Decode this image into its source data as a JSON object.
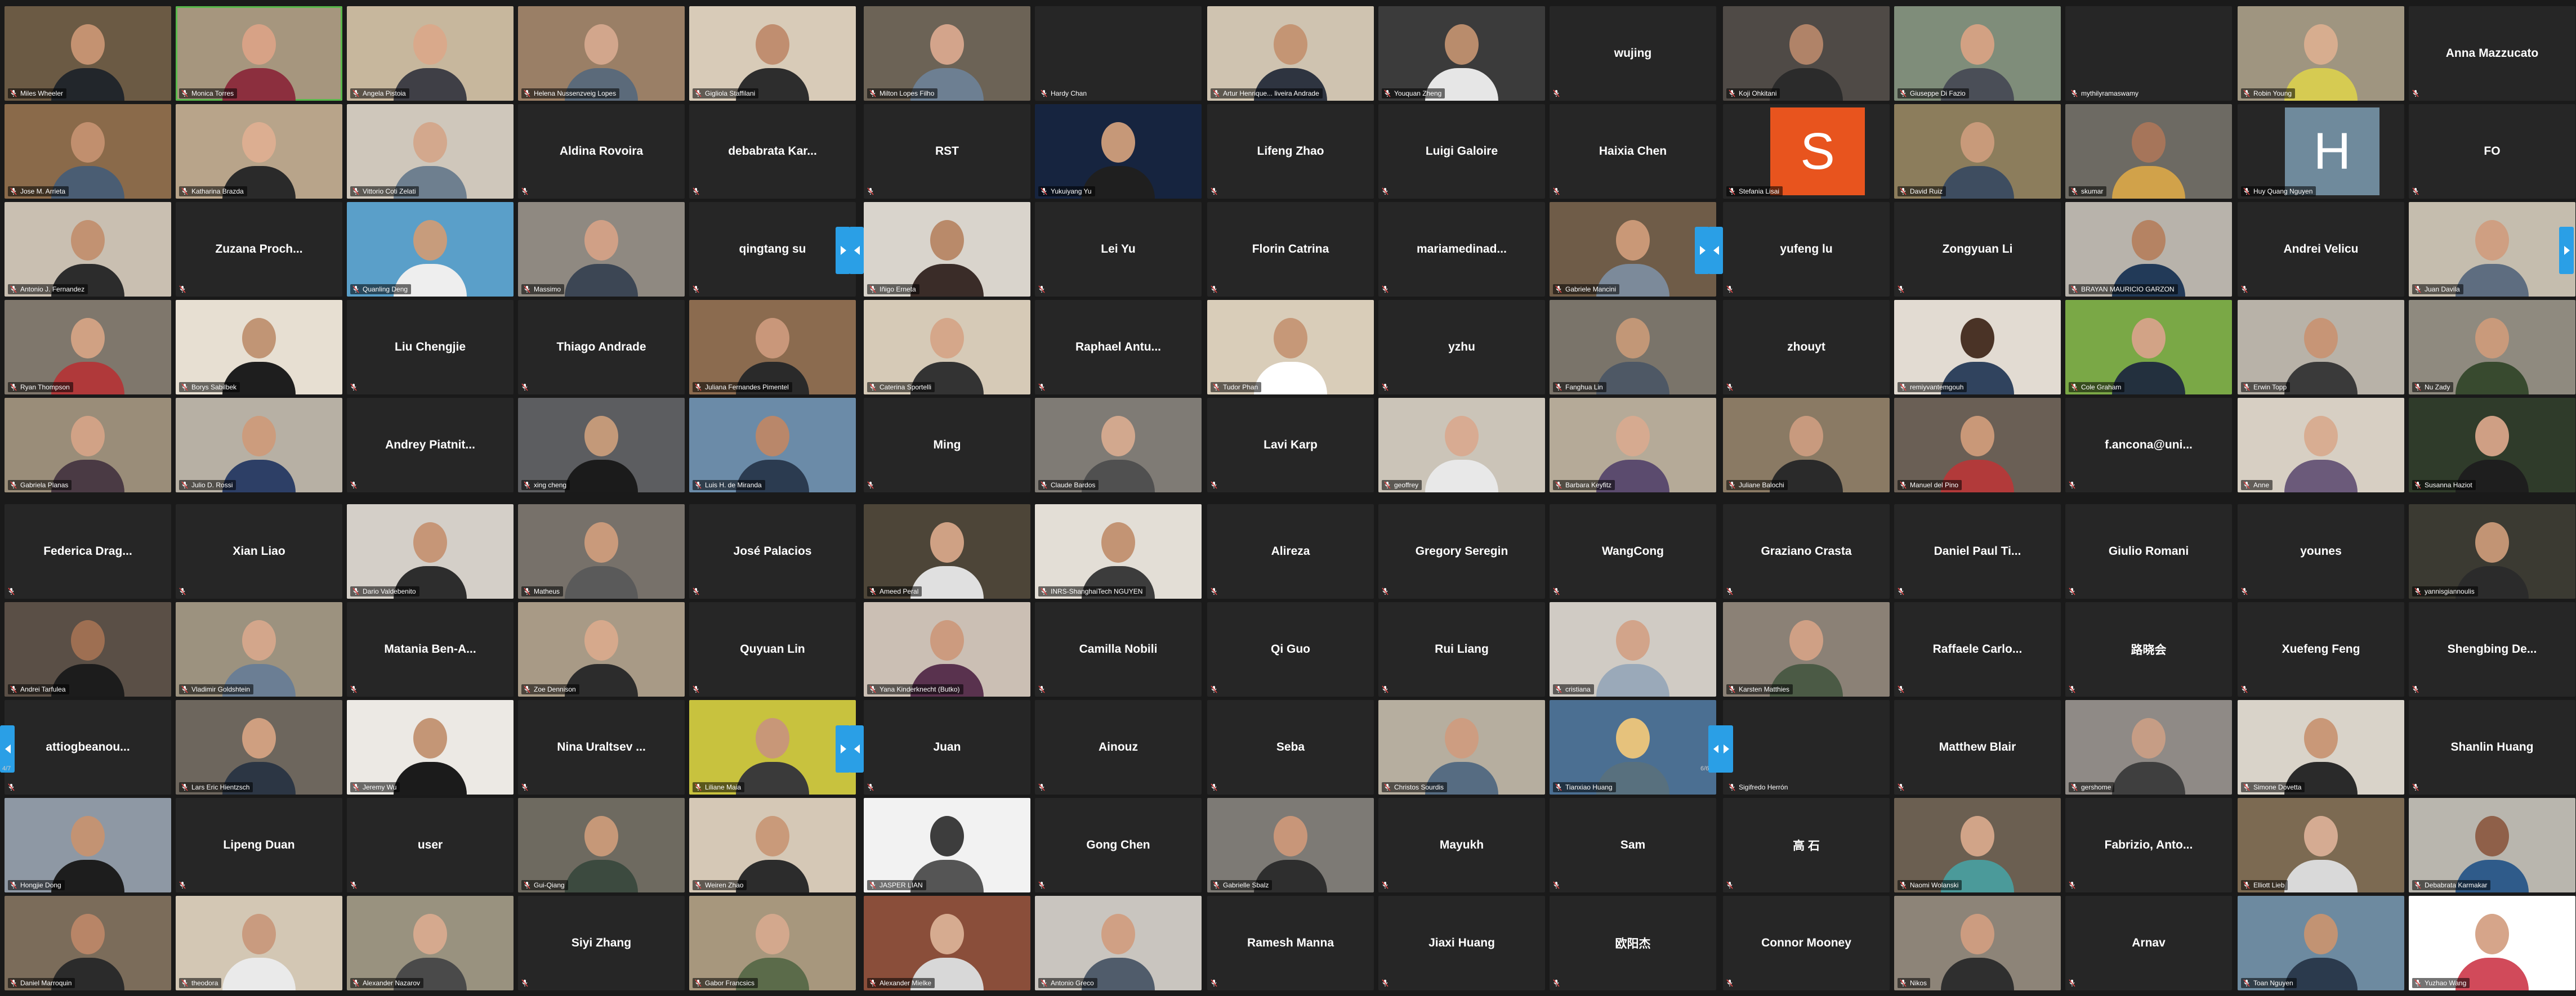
{
  "colors": {
    "background": "#1a1a1a",
    "tile_off": "#262626",
    "active_speaker_border": "#58b84b",
    "nav_arrow": "#2a9fe6",
    "mute_red": "#e34b4b"
  },
  "top": {
    "page_left": "",
    "page_mid": "",
    "page_right": "",
    "rows": [
      [
        {
          "name": "Miles Wheeler",
          "video": true,
          "bg": "#6b5a44",
          "skin": "#c49271",
          "shirt": "#22262b"
        },
        {
          "name": "Monica Torres",
          "video": true,
          "active": true,
          "bg": "#a6967e",
          "skin": "#d7a286",
          "shirt": "#8c2f3e"
        },
        {
          "name": "Angela Pistoia",
          "video": true,
          "bg": "#c7b79d",
          "skin": "#d9a98b",
          "shirt": "#3f3f46"
        },
        {
          "name": "Helena Nussenzveig Lopes",
          "video": true,
          "bg": "#9a7f66",
          "skin": "#d2a68c",
          "shirt": "#5b6a7a"
        },
        {
          "name": "Gigliola Staffilani",
          "video": true,
          "bg": "#d8cbb8",
          "skin": "#c08e70",
          "shirt": "#2d2d2d"
        },
        {
          "name": "Milton Lopes Filho",
          "video": true,
          "bg": "#6c6356",
          "skin": "#d3a48b",
          "shirt": "#6d7f92"
        },
        {
          "name": "Hardy Chan",
          "video": false,
          "label_bottom": true
        },
        {
          "name": "Artur Henrique... liveira Andrade",
          "video": true,
          "bg": "#cfc3b0",
          "skin": "#c49574",
          "shirt": "#2e3440"
        },
        {
          "name": "Youquan Zheng",
          "video": true,
          "bg": "#3b3b3b",
          "skin": "#b98c6c",
          "shirt": "#e6e6e6"
        },
        {
          "name": "wujing",
          "video": false
        },
        {
          "name": "Koji Ohkitani",
          "video": true,
          "bg": "#4f4a46",
          "skin": "#b08368",
          "shirt": "#2b2b2b"
        },
        {
          "name": "Giuseppe Di Fazio",
          "video": true,
          "bg": "#7f8d7a",
          "skin": "#d2a183",
          "shirt": "#4a4e57"
        },
        {
          "name": "mythilyramaswamy",
          "video": false,
          "label_bottom": true
        },
        {
          "name": "Robin Young",
          "video": true,
          "bg": "#9f9580",
          "skin": "#d7ad8f",
          "shirt": "#d6cb52"
        },
        {
          "name": "Anna Mazzucato",
          "video": false
        }
      ],
      [
        {
          "name": "Jose M. Arrieta",
          "video": true,
          "bg": "#8a6a4a",
          "skin": "#c18f6e",
          "shirt": "#4a5d73"
        },
        {
          "name": "Katharina Brazda",
          "video": true,
          "bg": "#b8a48a",
          "skin": "#dcae91",
          "shirt": "#2a2a2a"
        },
        {
          "name": "Vittorio Coti Zelati",
          "video": true,
          "bg": "#cfc7bb",
          "skin": "#d3a88d",
          "shirt": "#6e7f8f"
        },
        {
          "name": "Aldina Rovoira",
          "video": false
        },
        {
          "name": "debabrata Kar...",
          "video": false
        },
        {
          "name": "RST",
          "video": false
        },
        {
          "name": "Yukuiyang Yu",
          "video": true,
          "bg": "#16243f",
          "skin": "#c69878",
          "shirt": "#1f1f1f"
        },
        {
          "name": "Lifeng Zhao",
          "video": false
        },
        {
          "name": "Luigi Galoire",
          "video": false
        },
        {
          "name": "Haixia Chen",
          "video": false
        },
        {
          "name": "Stefania Lisai",
          "video": false,
          "avatar": "S",
          "avatar_color": "#e8541e",
          "label_bottom": true
        },
        {
          "name": "David Ruiz",
          "video": true,
          "bg": "#8c7d5c",
          "skin": "#c89a7a",
          "shirt": "#3e4d60"
        },
        {
          "name": "skumar",
          "video": true,
          "bg": "#6d6a63",
          "skin": "#a6755a",
          "shirt": "#d1a24a"
        },
        {
          "name": "Huy Quang Nguyen",
          "video": false,
          "avatar": "H",
          "avatar_color": "#6f8a9c",
          "label_bottom": true
        },
        {
          "name": "FO",
          "video": false
        }
      ],
      [
        {
          "name": "Antonio J. Fernandez",
          "video": true,
          "bg": "#c9bfb1",
          "skin": "#c29272",
          "shirt": "#2c2c2c"
        },
        {
          "name": "Zuzana Proch...",
          "video": false
        },
        {
          "name": "Quanling Deng",
          "video": true,
          "bg": "#5a9fc9",
          "skin": "#c79c7c",
          "shirt": "#eeeeee"
        },
        {
          "name": "Massimo",
          "video": true,
          "bg": "#8f8981",
          "skin": "#d0a086",
          "shirt": "#3c4654"
        },
        {
          "name": "qingtang su",
          "video": false
        },
        {
          "name": "Iñigo Erneta",
          "video": true,
          "bg": "#d9d4cc",
          "skin": "#b98a6a",
          "shirt": "#3a2c28"
        },
        {
          "name": "Lei Yu",
          "video": false
        },
        {
          "name": "Florin Catrina",
          "video": false
        },
        {
          "name": "mariamedinad...",
          "video": false
        },
        {
          "name": "Gabriele Mancini",
          "video": true,
          "bg": "#6f5c48",
          "skin": "#c99877",
          "shirt": "#7c8a9a"
        },
        {
          "name": "yufeng lu",
          "video": false
        },
        {
          "name": "Zongyuan Li",
          "video": false
        },
        {
          "name": "BRAYAN MAURICIO GARZON",
          "video": true,
          "bg": "#b8b3ab",
          "skin": "#b58363",
          "shirt": "#223a58"
        },
        {
          "name": "Andrei Velicu",
          "video": false
        },
        {
          "name": "Juan Davila",
          "video": true,
          "bg": "#c5bdae",
          "skin": "#cf9f82",
          "shirt": "#5e6d80"
        }
      ],
      [
        {
          "name": "Ryan Thompson",
          "video": true,
          "bg": "#7f776c",
          "skin": "#d0a183",
          "shirt": "#b0393a"
        },
        {
          "name": "Borys Sabilbek",
          "video": true,
          "bg": "#e7dfd2",
          "skin": "#c19575",
          "shirt": "#1e1e1e"
        },
        {
          "name": "Liu Chengjie",
          "video": false
        },
        {
          "name": "Thiago Andrade",
          "video": false
        },
        {
          "name": "Juliana Fernandes Pimentel",
          "video": true,
          "bg": "#8b6b4f",
          "skin": "#c9977a",
          "shirt": "#2a2a2a"
        },
        {
          "name": "Caterina Sportelli",
          "video": true,
          "bg": "#d6cab7",
          "skin": "#d5a78a",
          "shirt": "#333333"
        },
        {
          "name": "Raphael Antu...",
          "video": false
        },
        {
          "name": "Tudor Phan",
          "video": true,
          "bg": "#d9cdb9",
          "skin": "#c69878",
          "shirt": "#ffffff"
        },
        {
          "name": "yzhu",
          "video": false
        },
        {
          "name": "Fanghua Lin",
          "video": true,
          "bg": "#7a746a",
          "skin": "#c29777",
          "shirt": "#4e5865"
        },
        {
          "name": "zhouyt",
          "video": false
        },
        {
          "name": "remiyvantemgouh",
          "video": true,
          "bg": "#e2dbd2",
          "skin": "#4a3326",
          "shirt": "#30435e"
        },
        {
          "name": "Cole Graham",
          "video": true,
          "bg": "#7aa846",
          "skin": "#d2a386",
          "shirt": "#23303e"
        },
        {
          "name": "Erwin Topp",
          "video": true,
          "bg": "#b8b2a8",
          "skin": "#c79576",
          "shirt": "#3a3a3a"
        },
        {
          "name": "Nu Zady",
          "video": true,
          "bg": "#8f8a7f",
          "skin": "#c99a7b",
          "shirt": "#384a2f"
        }
      ],
      [
        {
          "name": "Gabriela Planas",
          "video": true,
          "bg": "#9a8d79",
          "skin": "#d1a286",
          "shirt": "#4a3a44"
        },
        {
          "name": "Julio D. Rossi",
          "video": true,
          "bg": "#b7b0a4",
          "skin": "#cc9c7d",
          "shirt": "#2d3f66"
        },
        {
          "name": "Andrey Piatnit...",
          "video": false
        },
        {
          "name": "xing cheng",
          "video": true,
          "bg": "#5c5d60",
          "skin": "#c39979",
          "shirt": "#1b1b1b"
        },
        {
          "name": "Luis H. de Miranda",
          "video": true,
          "bg": "#6b8ba8",
          "skin": "#b9876a",
          "shirt": "#2b3b50"
        },
        {
          "name": "Ming",
          "video": false
        },
        {
          "name": "Claude Bardos",
          "video": true,
          "bg": "#7f7b75",
          "skin": "#d2a88e",
          "shirt": "#505050"
        },
        {
          "name": "Lavi Karp",
          "video": false
        },
        {
          "name": "geoffrey",
          "video": true,
          "bg": "#cbc4b8",
          "skin": "#d8ab92",
          "shirt": "#e8e8e8"
        },
        {
          "name": "Barbara Keyfitz",
          "video": true,
          "bg": "#b5aa98",
          "skin": "#d6aa90",
          "shirt": "#5b4b6e"
        },
        {
          "name": "Juliane Balochi",
          "video": true,
          "bg": "#8a7a64",
          "skin": "#c89a7e",
          "shirt": "#2a2a2a"
        },
        {
          "name": "Manuel del Pino",
          "video": true,
          "bg": "#6a5f55",
          "skin": "#c99878",
          "shirt": "#b23a3a"
        },
        {
          "name": "f.ancona@uni...",
          "video": false
        },
        {
          "name": "Anne",
          "video": true,
          "bg": "#d7cfc3",
          "skin": "#d8ad92",
          "shirt": "#6b5a7a"
        },
        {
          "name": "Susanna Haziot",
          "video": true,
          "bg": "#2f3b2a",
          "skin": "#cf9f84",
          "shirt": "#1e1e1e"
        }
      ]
    ]
  },
  "bottom": {
    "page_left": "4/7",
    "page_right": "6/6",
    "rows": [
      [
        {
          "name": "Federica Drag...",
          "video": false
        },
        {
          "name": "Xian Liao",
          "video": false
        },
        {
          "name": "Dario Valdebenito",
          "video": true,
          "bg": "#d4cfc8",
          "skin": "#c69677",
          "shirt": "#2d2d2d"
        },
        {
          "name": "Matheus",
          "video": true,
          "bg": "#77716a",
          "skin": "#c99a7b",
          "shirt": "#5a5a5a"
        },
        {
          "name": "José Palacios",
          "video": false
        },
        {
          "name": "Ameed Peral",
          "video": true,
          "bg": "#4d4538",
          "skin": "#cfa184",
          "shirt": "#e0e0e0"
        },
        {
          "name": "INRS-ShanghaiTech NGUYEN",
          "video": true,
          "bg": "#e3ded6",
          "skin": "#c39474",
          "shirt": "#3c3c3c"
        },
        {
          "name": "Alireza",
          "video": false
        },
        {
          "name": "Gregory Seregin",
          "video": false
        },
        {
          "name": "WangCong",
          "video": false
        },
        {
          "name": "Graziano Crasta",
          "video": false
        },
        {
          "name": "Daniel Paul Ti...",
          "video": false
        },
        {
          "name": "Giulio Romani",
          "video": false
        },
        {
          "name": "younes",
          "video": false
        },
        {
          "name": "yannisgiannoulis",
          "video": true,
          "bg": "#3b3a32",
          "skin": "#c29474",
          "shirt": "#2b2b2b"
        }
      ],
      [
        {
          "name": "Andrei Tarfulea",
          "video": true,
          "bg": "#5a4f46",
          "skin": "#9e6f52",
          "shirt": "#1c1c1c"
        },
        {
          "name": "Vladimir Goldshtein",
          "video": true,
          "bg": "#9c927f",
          "skin": "#d3a68b",
          "shirt": "#6b7e94"
        },
        {
          "name": "Matania Ben-A...",
          "video": false
        },
        {
          "name": "Zoe Dennison",
          "video": true,
          "bg": "#a89a86",
          "skin": "#d6a98c",
          "shirt": "#2c2c2c"
        },
        {
          "name": "Quyuan Lin",
          "video": false
        },
        {
          "name": "Yana Kinderknecht (Butko)",
          "video": true,
          "bg": "#cbbfb4",
          "skin": "#cc9b7f",
          "shirt": "#59324e"
        },
        {
          "name": "Camilla Nobili",
          "video": false
        },
        {
          "name": "Qi Guo",
          "video": false
        },
        {
          "name": "Rui Liang",
          "video": false
        },
        {
          "name": "cristiana",
          "video": true,
          "bg": "#d0cbc4",
          "skin": "#d2a48a",
          "shirt": "#9aa9b9"
        },
        {
          "name": "Karsten Matthies",
          "video": true,
          "bg": "#8b8176",
          "skin": "#cfa085",
          "shirt": "#4b5a45"
        },
        {
          "name": "Raffaele Carlo...",
          "video": false
        },
        {
          "name": "路晓会",
          "video": false
        },
        {
          "name": "Xuefeng Feng",
          "video": false
        },
        {
          "name": "Shengbing De...",
          "video": false
        }
      ],
      [
        {
          "name": "attiogbeanou...",
          "video": false
        },
        {
          "name": "Lars Eric Hientzsch",
          "video": true,
          "bg": "#6d665d",
          "skin": "#cf9f80",
          "shirt": "#2c3644"
        },
        {
          "name": "Jeremy Wu",
          "video": true,
          "bg": "#ece9e4",
          "skin": "#c49676",
          "shirt": "#1b1b1b"
        },
        {
          "name": "Nina Uraltsev ...",
          "video": false
        },
        {
          "name": "Liliane Maia",
          "video": true,
          "bg": "#c8c23e",
          "skin": "#c89778",
          "shirt": "#3a3a3a"
        },
        {
          "name": "Juan",
          "video": false
        },
        {
          "name": "Ainouz",
          "video": false
        },
        {
          "name": "Seba",
          "video": false
        },
        {
          "name": "Christos Sourdis",
          "video": true,
          "bg": "#b6ae9f",
          "skin": "#cd9d81",
          "shirt": "#566c82"
        },
        {
          "name": "Tianxiao Huang",
          "video": true,
          "bg": "#4b6f92",
          "skin": "#e6c27c",
          "shirt": "#58707e"
        },
        {
          "name": "Sigifredo Herrón",
          "video": false,
          "label_bottom": true
        },
        {
          "name": "Matthew Blair",
          "video": false
        },
        {
          "name": "gershome",
          "video": true,
          "bg": "#8f8a86",
          "skin": "#c69d85",
          "shirt": "#3f3f3f"
        },
        {
          "name": "Simone Dovetta",
          "video": true,
          "bg": "#d9d3c9",
          "skin": "#c99878",
          "shirt": "#2a2a2a"
        },
        {
          "name": "Shanlin Huang",
          "video": false
        }
      ],
      [
        {
          "name": "Hongjie Dong",
          "video": true,
          "bg": "#8e98a4",
          "skin": "#c39373",
          "shirt": "#1d1d1d"
        },
        {
          "name": "Lipeng Duan",
          "video": false
        },
        {
          "name": "user",
          "video": false
        },
        {
          "name": "Gui-Qiang",
          "video": true,
          "bg": "#6e6a60",
          "skin": "#c69878",
          "shirt": "#3c4a3f"
        },
        {
          "name": "Weiren Zhao",
          "video": true,
          "bg": "#d5c8b6",
          "skin": "#c99a7a",
          "shirt": "#2c2c2c"
        },
        {
          "name": "JASPER LIAN",
          "video": true,
          "bg": "#f2f2f2",
          "skin": "#3d3d3d",
          "shirt": "#555555"
        },
        {
          "name": "Gong Chen",
          "video": false
        },
        {
          "name": "Gabrielle Sbalz",
          "video": true,
          "bg": "#7d7a75",
          "skin": "#c89679",
          "shirt": "#2e2e2e"
        },
        {
          "name": "Mayukh",
          "video": false
        },
        {
          "name": "Sam",
          "video": false
        },
        {
          "name": "高 石",
          "video": false
        },
        {
          "name": "Naomi Wolanski",
          "video": true,
          "bg": "#6b5f51",
          "skin": "#d1a488",
          "shirt": "#4b9a9a"
        },
        {
          "name": "Fabrizio, Anto...",
          "video": false
        },
        {
          "name": "Elliott Lieb",
          "video": true,
          "bg": "#7c6a52",
          "skin": "#d5ab92",
          "shirt": "#d9d9d9"
        },
        {
          "name": "Debabrata Karmakar",
          "video": true,
          "bg": "#b9b6ae",
          "skin": "#8f6049",
          "shirt": "#2f5b8a"
        }
      ],
      [
        {
          "name": "Daniel Marroquin",
          "video": true,
          "bg": "#7b6c5a",
          "skin": "#b88567",
          "shirt": "#2b2b2b"
        },
        {
          "name": "theodora",
          "video": true,
          "bg": "#d3c7b4",
          "skin": "#c99b7f",
          "shirt": "#eaeaea"
        },
        {
          "name": "Alexander Nazarov",
          "video": true,
          "bg": "#99927f",
          "skin": "#d5a98e",
          "shirt": "#4a4a4a"
        },
        {
          "name": "Siyi Zhang",
          "video": false
        },
        {
          "name": "Gabor Francsics",
          "video": true,
          "bg": "#a7977d",
          "skin": "#d3a88d",
          "shirt": "#5b6b4a"
        },
        {
          "name": "Alexander Mielke",
          "video": true,
          "bg": "#8a4e3a",
          "skin": "#d6ab90",
          "shirt": "#d8d8d8"
        },
        {
          "name": "Antonio Greco",
          "video": true,
          "bg": "#c9c5bf",
          "skin": "#d0a084",
          "shirt": "#505c6b"
        },
        {
          "name": "Ramesh Manna",
          "video": false
        },
        {
          "name": "Jiaxi Huang",
          "video": false
        },
        {
          "name": "欧阳杰",
          "video": false
        },
        {
          "name": "Connor Mooney",
          "video": false
        },
        {
          "name": "Nikos",
          "video": true,
          "bg": "#8d8478",
          "skin": "#cc9c80",
          "shirt": "#2f2f2f"
        },
        {
          "name": "Arnav",
          "video": false
        },
        {
          "name": "Toan Nguyen",
          "video": true,
          "bg": "#6d8aa0",
          "skin": "#c29373",
          "shirt": "#2b3a4d"
        },
        {
          "name": "Yuzhao Wang",
          "video": true,
          "bg": "#ffffff",
          "skin": "#d6a58a",
          "shirt": "#d14a5a"
        }
      ]
    ]
  }
}
